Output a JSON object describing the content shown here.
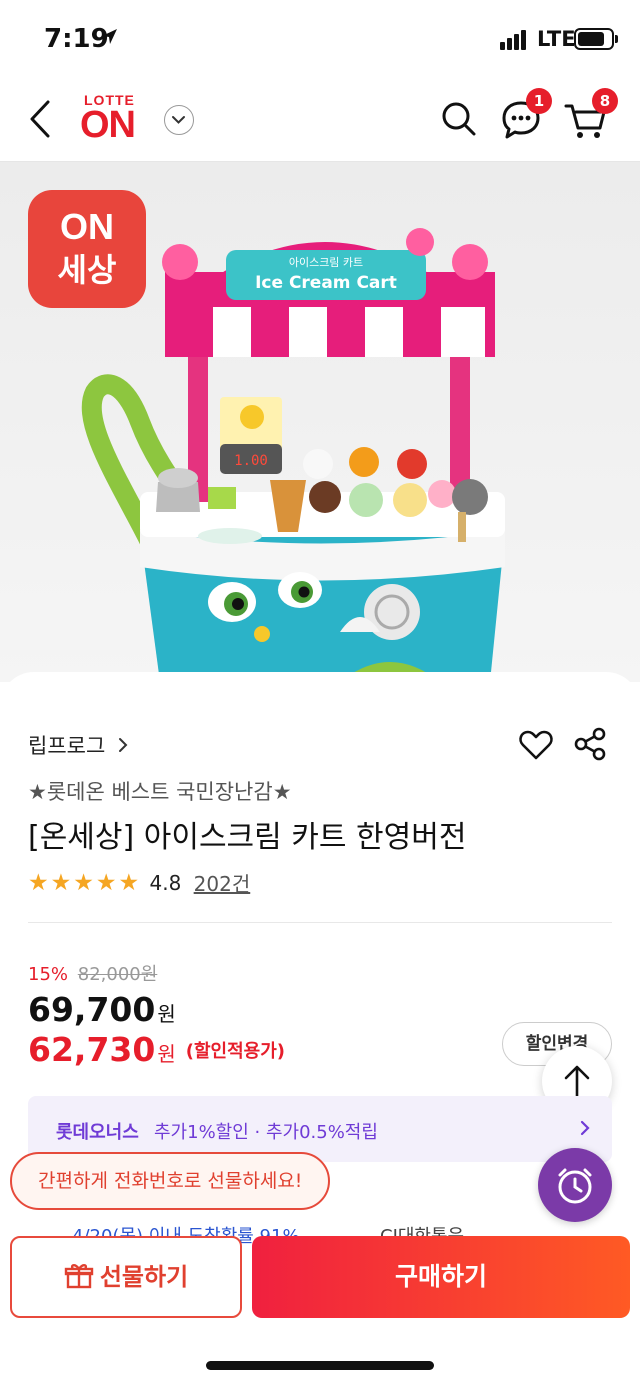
{
  "status_bar": {
    "time": "7:19",
    "network": "LTE"
  },
  "header": {
    "logo_top": "LOTTE",
    "logo_main": "ON",
    "chat_badge": "1",
    "cart_badge": "8"
  },
  "hero": {
    "badge_line1": "ON",
    "badge_line2": "세상",
    "sign_kr": "아이스크림 카트",
    "sign_en": "Ice Cream Cart",
    "display_digits": "1.00"
  },
  "product": {
    "brand": "립프로그",
    "promo": "★롯데온 베스트 국민장난감★",
    "title": "[온세상] 아이스크림 카트 한영버전",
    "rating": "4.8",
    "rating_value": 4.8,
    "review_count": "202건",
    "discount_pct": "15%",
    "original_price": "82,000원",
    "price": "69,700",
    "sale_price": "62,730",
    "won": "원",
    "sale_tag": "(할인적용가)",
    "coupon_button": "할인변경"
  },
  "membership": {
    "name": "롯데오너스",
    "benefit": "추가1%할인 · 추가0.5%적립"
  },
  "delivery": {
    "text": "4/20(목) 이내 도착확률 91%",
    "carrier": "CJ대한통운"
  },
  "tooltip": "간편하게 전화번호로 선물하세요!",
  "actions": {
    "gift": "선물하기",
    "buy": "구매하기"
  },
  "colors": {
    "brand_red": "#e61e2b",
    "member_purple": "#6f3bd6",
    "buy_gradient_start": "#f0203f",
    "buy_gradient_end": "#ff5a24"
  }
}
